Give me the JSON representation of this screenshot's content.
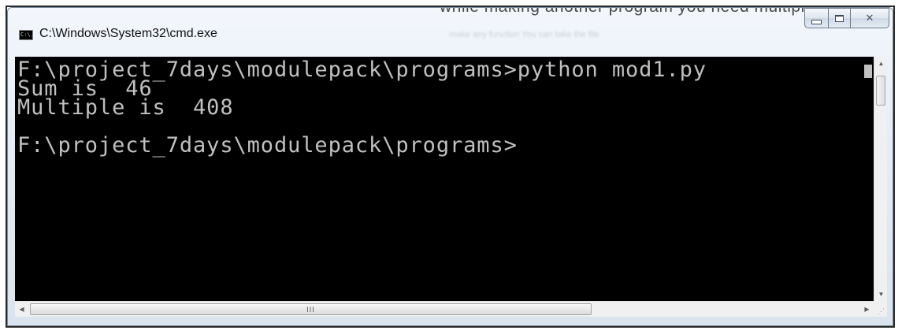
{
  "background_document": {
    "text": "while making another program you need multiplication",
    "faded_text": "make any function  You can take the file"
  },
  "window": {
    "title": "C:\\Windows\\System32\\cmd.exe",
    "icon_label": "C:\\."
  },
  "caption_buttons": {
    "close_glyph": "✕"
  },
  "console": {
    "text": "F:\\project_7days\\modulepack\\programs>python mod1.py\nSum is  46\nMultiple is  408\n\nF:\\project_7days\\modulepack\\programs>",
    "colors": {
      "background": "#000000",
      "foreground": "#c0c0c0"
    }
  },
  "scrollbars": {
    "vertical": {
      "up_arrow": "▲",
      "down_arrow": "▼"
    },
    "horizontal": {
      "left_arrow": "◀",
      "right_arrow": "▶",
      "grip": "III"
    }
  },
  "size_grip": {
    "glyph": "⋰"
  },
  "colors": {
    "frame_border": "#7a8a99",
    "titlebar_top": "#f3f7fc",
    "titlebar_bottom": "#dae4ef"
  }
}
